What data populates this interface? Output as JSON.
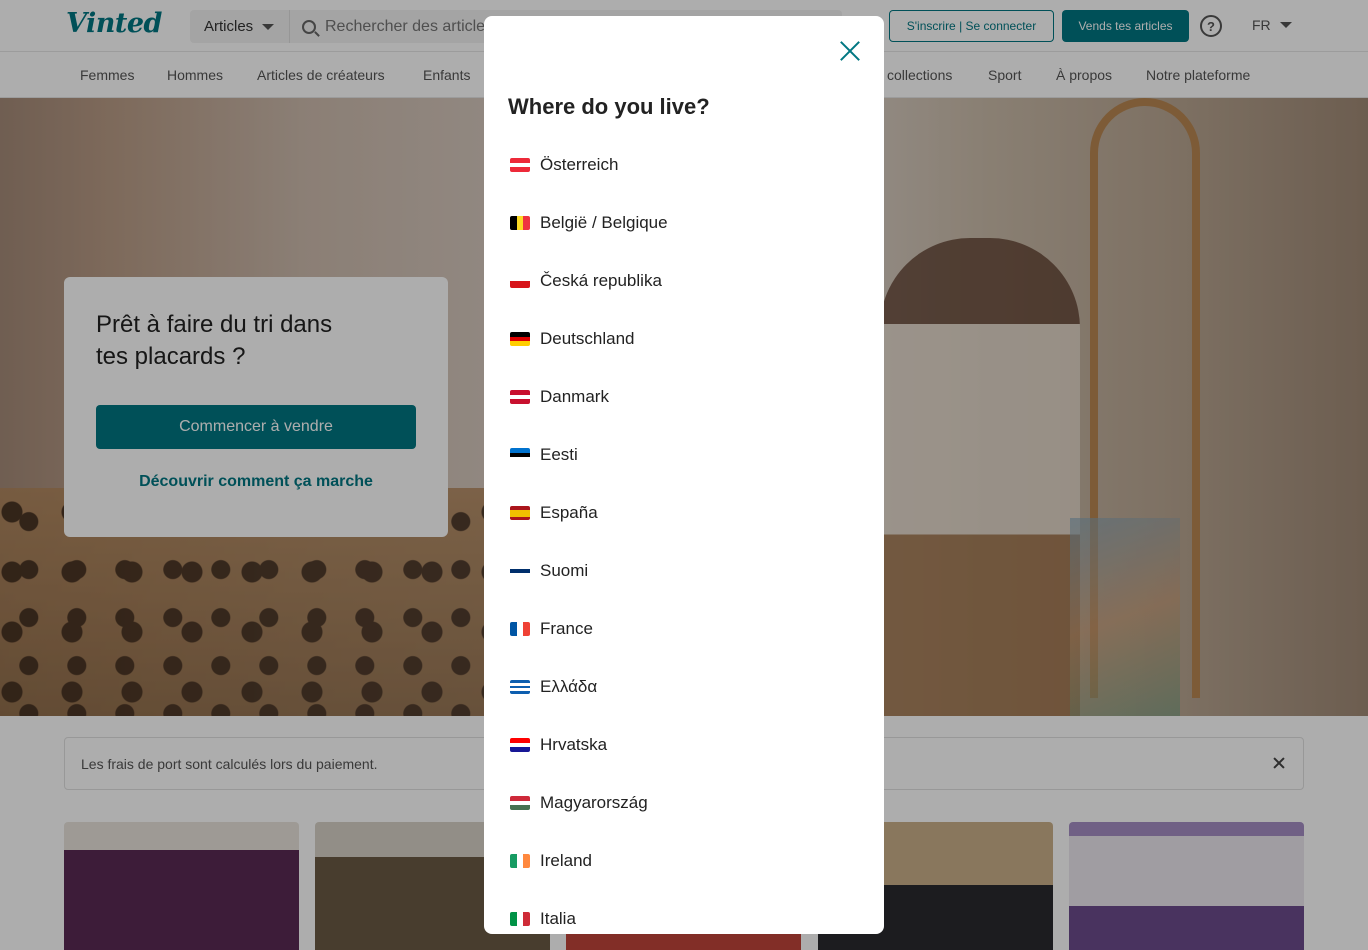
{
  "header": {
    "logo": "Vinted",
    "search_category": "Articles",
    "search_placeholder": "Rechercher des articles",
    "signup_login": "S'inscrire | Se connecter",
    "sell_button": "Vends tes articles",
    "language": "FR"
  },
  "nav": {
    "items": [
      "Femmes",
      "Hommes",
      "Articles de créateurs",
      "Enfants",
      "collections",
      "Sport",
      "À propos",
      "Notre plateforme"
    ]
  },
  "hero": {
    "title": "Prêt à faire du tri dans tes placards ?",
    "cta": "Commencer à vendre",
    "link": "Découvrir comment ça marche"
  },
  "banner": {
    "text": "Les frais de port sont calculés lors du paiement."
  },
  "modal": {
    "title": "Where do you live?",
    "countries": [
      {
        "name": "Österreich",
        "flag": [
          "#ed2939",
          "#ffffff",
          "#ed2939"
        ],
        "dir": "h"
      },
      {
        "name": "België / Belgique",
        "flag": [
          "#000000",
          "#fdda24",
          "#ef3340"
        ],
        "dir": "v"
      },
      {
        "name": "Česká republika",
        "flag": [
          "#ffffff",
          "#d7141a"
        ],
        "dir": "h"
      },
      {
        "name": "Deutschland",
        "flag": [
          "#000000",
          "#dd0000",
          "#ffce00"
        ],
        "dir": "h"
      },
      {
        "name": "Danmark",
        "flag": [
          "#c8102e",
          "#ffffff",
          "#c8102e"
        ],
        "dir": "h"
      },
      {
        "name": "Eesti",
        "flag": [
          "#0072ce",
          "#000000",
          "#ffffff"
        ],
        "dir": "h"
      },
      {
        "name": "España",
        "flag": [
          "#aa151b",
          "#f1bf00",
          "#f1bf00",
          "#aa151b"
        ],
        "dir": "h"
      },
      {
        "name": "Suomi",
        "flag": [
          "#ffffff",
          "#002f6c",
          "#ffffff"
        ],
        "dir": "h"
      },
      {
        "name": "France",
        "flag": [
          "#0055a4",
          "#ffffff",
          "#ef4135"
        ],
        "dir": "v"
      },
      {
        "name": "Ελλάδα",
        "flag": [
          "#0d5eaf",
          "#ffffff",
          "#0d5eaf",
          "#ffffff",
          "#0d5eaf"
        ],
        "dir": "h"
      },
      {
        "name": "Hrvatska",
        "flag": [
          "#ff0000",
          "#ffffff",
          "#171796"
        ],
        "dir": "h"
      },
      {
        "name": "Magyarország",
        "flag": [
          "#ce2939",
          "#ffffff",
          "#477050"
        ],
        "dir": "h"
      },
      {
        "name": "Ireland",
        "flag": [
          "#169b62",
          "#ffffff",
          "#ff883e"
        ],
        "dir": "v"
      },
      {
        "name": "Italia",
        "flag": [
          "#009246",
          "#ffffff",
          "#ce2b37"
        ],
        "dir": "v"
      }
    ]
  },
  "colors": {
    "brand": "#007782",
    "overlay": "rgba(0,0,0,0.32)"
  }
}
